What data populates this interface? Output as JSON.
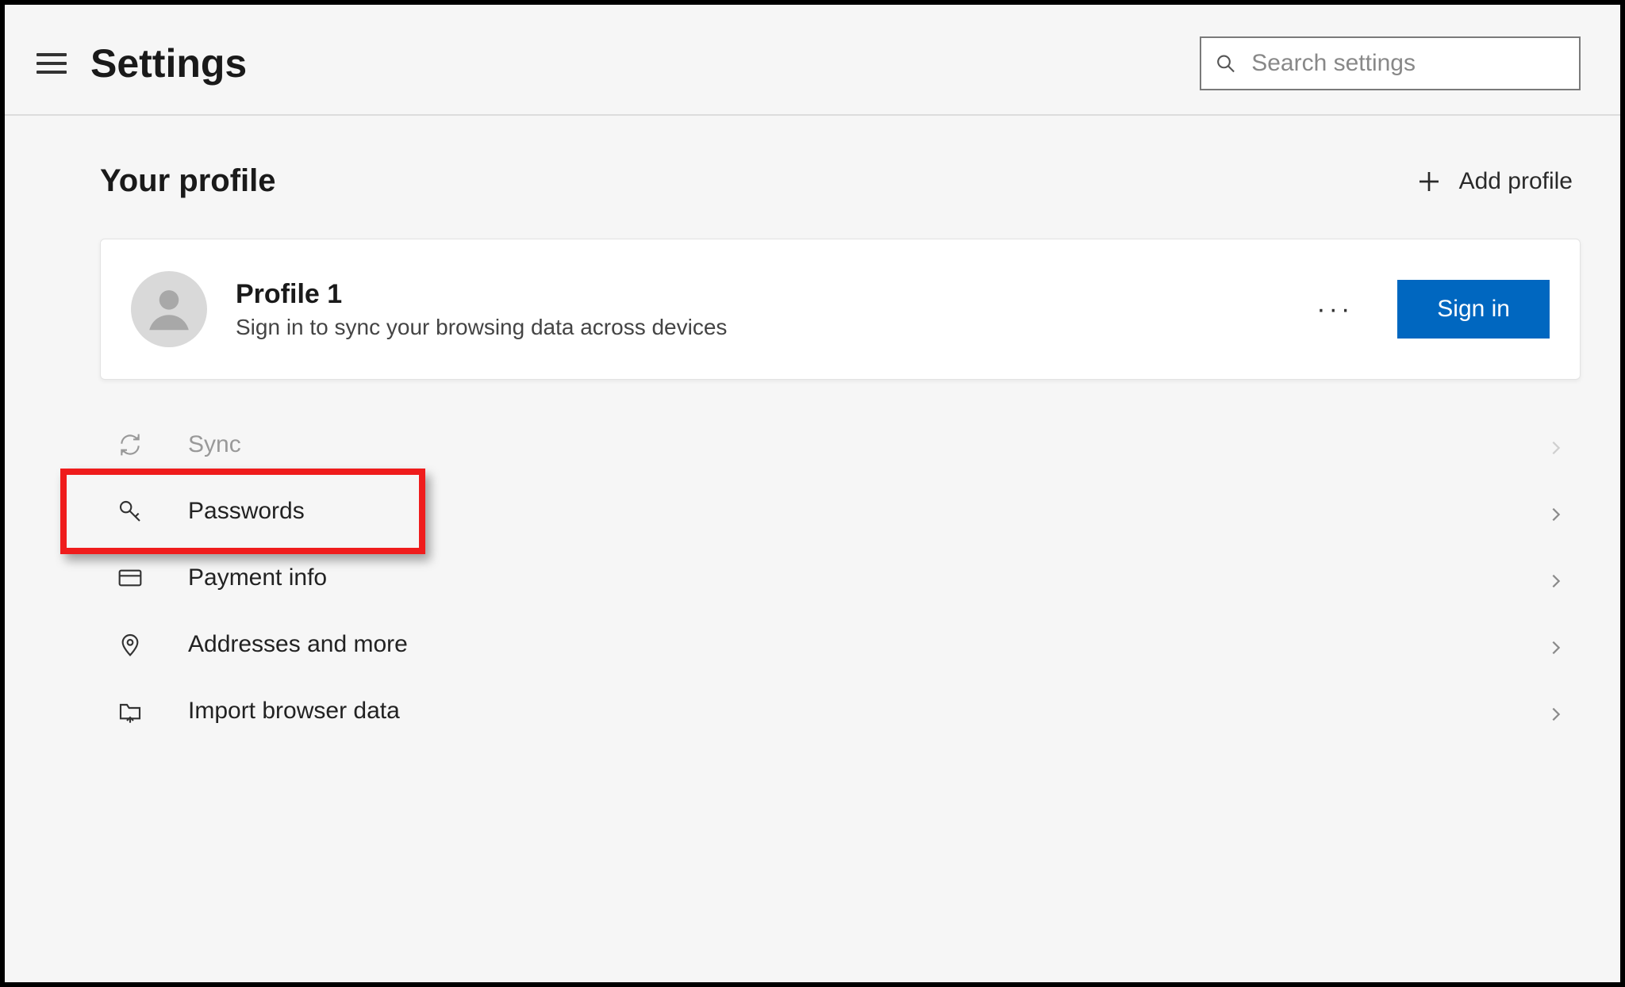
{
  "header": {
    "title": "Settings",
    "search_placeholder": "Search settings"
  },
  "profile_section": {
    "title": "Your profile",
    "add_label": "Add profile"
  },
  "profile_card": {
    "name": "Profile 1",
    "description": "Sign in to sync your browsing data across devices",
    "more": "···",
    "sign_in": "Sign in"
  },
  "items": [
    {
      "key": "sync",
      "label": "Sync",
      "disabled": true
    },
    {
      "key": "passwords",
      "label": "Passwords",
      "disabled": false,
      "highlighted": true
    },
    {
      "key": "payment",
      "label": "Payment info",
      "disabled": false
    },
    {
      "key": "addresses",
      "label": "Addresses and more",
      "disabled": false
    },
    {
      "key": "import",
      "label": "Import browser data",
      "disabled": false
    }
  ]
}
